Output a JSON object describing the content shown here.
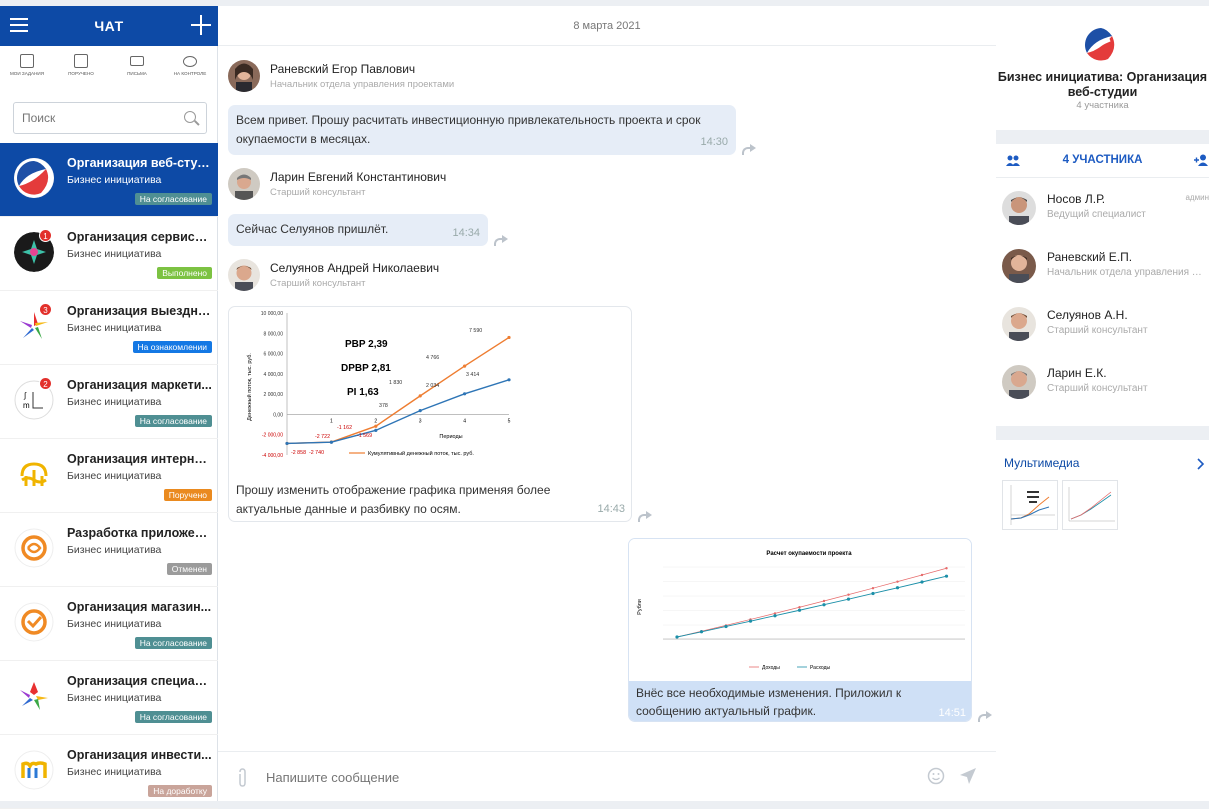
{
  "sidebar": {
    "title": "ЧАТ",
    "quick_actions": [
      {
        "label": "МОИ ЗАДАНИЯ",
        "icon": "clipboard-icon"
      },
      {
        "label": "ПОРУЧЕНО",
        "icon": "assign-icon"
      },
      {
        "label": "ПИСЬМА",
        "icon": "envelope-icon"
      },
      {
        "label": "НА КОНТРОЛЕ",
        "icon": "eye-icon"
      }
    ],
    "search_placeholder": "Поиск",
    "chats": [
      {
        "title": "Организация веб-студ...",
        "subtitle": "Бизнес инициатива",
        "badge": "На согласование",
        "badge_color": "#4f8f93",
        "selected": true,
        "unread": ""
      },
      {
        "title": "Организация сервиса ...",
        "subtitle": "Бизнес инициатива",
        "badge": "Выполнено",
        "badge_color": "#7cc242",
        "unread": "1"
      },
      {
        "title": "Организация выездно...",
        "subtitle": "Бизнес инициатива",
        "badge": "На ознакомлении",
        "badge_color": "#1478e4",
        "unread": "3"
      },
      {
        "title": "Организация маркети...",
        "subtitle": "Бизнес инициатива",
        "badge": "На согласование",
        "badge_color": "#4f8f93",
        "unread": "2"
      },
      {
        "title": "Организация интернет...",
        "subtitle": "Бизнес инициатива",
        "badge": "Поручено",
        "badge_color": "#ea8a1f",
        "unread": ""
      },
      {
        "title": "Разработка приложен...",
        "subtitle": "Бизнес инициатива",
        "badge": "Отменен",
        "badge_color": "#9b9b9b",
        "unread": ""
      },
      {
        "title": "Организация магазин...",
        "subtitle": "Бизнес инициатива",
        "badge": "На согласование",
        "badge_color": "#4f8f93",
        "unread": ""
      },
      {
        "title": "Организация специал...",
        "subtitle": "Бизнес инициатива",
        "badge": "На согласование",
        "badge_color": "#4f8f93",
        "unread": ""
      },
      {
        "title": "Организация инвести...",
        "subtitle": "Бизнес инициатива",
        "badge": "На доработку",
        "badge_color": "#c9a49a",
        "unread": ""
      }
    ]
  },
  "chat": {
    "date": "8 марта 2021",
    "messages": [
      {
        "sender": "Раневский Егор Павлович",
        "role": "Начальник отдела управления проектами",
        "text": "Всем привет. Прошу расчитать инвестиционную привлекательность проекта и срок окупаемости в месяцах.",
        "time": "14:30"
      },
      {
        "sender": "Ларин Евгений Константинович",
        "role": "Старший консультант",
        "text": "Сейчас Селуянов пришлёт.",
        "time": "14:34"
      },
      {
        "sender": "Селуянов Андрей Николаевич",
        "role": "Старший консультант",
        "text": "Прошу изменить отображение графика применяя более актуальные данные и разбивку по осям.",
        "time": "14:43"
      }
    ],
    "outgoing": {
      "text": "Внёс все необходимые изменения. Приложил к сообщению актуальный график.",
      "time": "14:51"
    },
    "input_placeholder": "Напишите сообщение"
  },
  "attachment_chart": {
    "ylabel": "Денежный поток, тыс. руб.",
    "xlabel": "Периоды",
    "legend": "Кумулятивный денежный поток, тыс. руб.",
    "annotations": [
      "PBP 2,39",
      "DPBP 2,81",
      "PI 1,63"
    ],
    "y_ticks": [
      "10 000,00",
      "8 000,00",
      "6 000,00",
      "4 000,00",
      "2 000,00",
      "0,00",
      "-2 000,00",
      "-4 000,00"
    ],
    "x_ticks": [
      "1",
      "2",
      "3",
      "4",
      "5"
    ],
    "point_labels": [
      "-2 858",
      "-2 740",
      "-2 722",
      "-1 162",
      "-1 569",
      "378",
      "1 830",
      "2 034",
      "4 766",
      "3 414",
      "7 590"
    ]
  },
  "chart_data": {
    "type": "line",
    "title": "",
    "xlabel": "Периоды",
    "ylabel": "Денежный поток, тыс. руб.",
    "ylim": [
      -4000,
      10000
    ],
    "x": [
      0,
      1,
      2,
      3,
      4,
      5
    ],
    "series": [
      {
        "name": "Кумулятивный денежный поток, тыс. руб.",
        "values": [
          -2858,
          -2722,
          -1162,
          1830,
          4766,
          7590
        ],
        "color": "#ee7d31"
      },
      {
        "values": [
          -2858,
          -2740,
          -1569,
          378,
          2034,
          3414
        ],
        "color": "#2e75b6"
      }
    ],
    "legend": "bottom"
  },
  "outgoing_chart": {
    "title": "Расчет окупаемости проекта",
    "ylabel": "Рубли",
    "legend": [
      "Доходы",
      "Расходы"
    ],
    "colors": [
      "#e66b6b",
      "#1b8fa8"
    ]
  },
  "right": {
    "title": "Бизнес инициатива: Организация веб-студии",
    "count": "4 участника",
    "participants_label": "4 УЧАСТНИКА",
    "members": [
      {
        "name": "Носов Л.Р.",
        "role": "Ведущий специалист",
        "tag": "админ"
      },
      {
        "name": "Раневский Е.П.",
        "role": "Начальник отдела управления проектами",
        "tag": ""
      },
      {
        "name": "Селуянов А.Н.",
        "role": "Старший консультант",
        "tag": ""
      },
      {
        "name": "Ларин Е.К.",
        "role": "Старший консультант",
        "tag": ""
      }
    ],
    "media_label": "Мультимедиа"
  },
  "colors": {
    "brand": "#0d4aa6",
    "bubble": "#e6edf7",
    "outgoing_bubble": "#cfe0f6"
  }
}
